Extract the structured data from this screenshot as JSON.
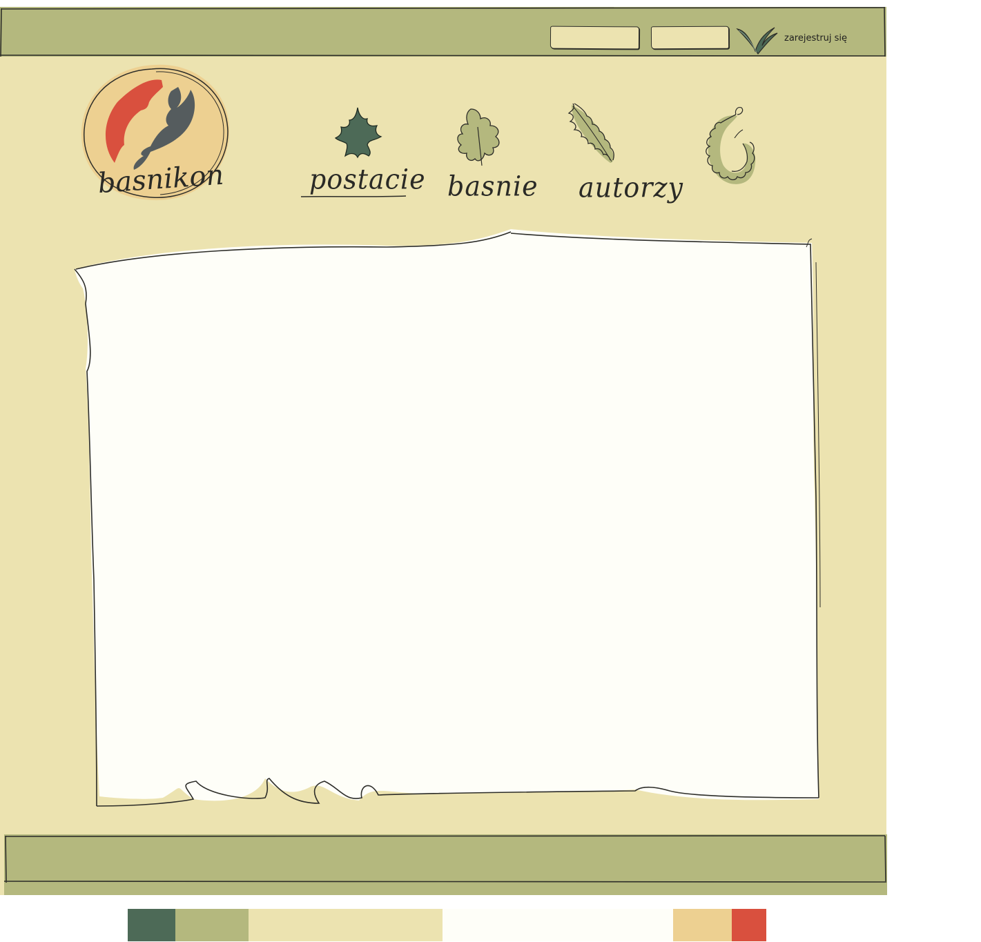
{
  "header": {
    "register_label": "zarejestruj się",
    "login_placeholder": "",
    "password_placeholder": ""
  },
  "logo": {
    "text": "basnikon"
  },
  "nav": [
    {
      "label": "postacie",
      "icon": "maple-leaf-icon"
    },
    {
      "label": "basnie",
      "icon": "oak-leaf-icon"
    },
    {
      "label": "autorzy",
      "icon": "fern-leaf-icon"
    },
    {
      "label": "",
      "icon": "curled-leaf-icon"
    }
  ],
  "palette": {
    "colors": [
      "#4d6a57",
      "#b4b87e",
      "#ece3b0",
      "#fefef8",
      "#edd091",
      "#d9503e"
    ]
  }
}
